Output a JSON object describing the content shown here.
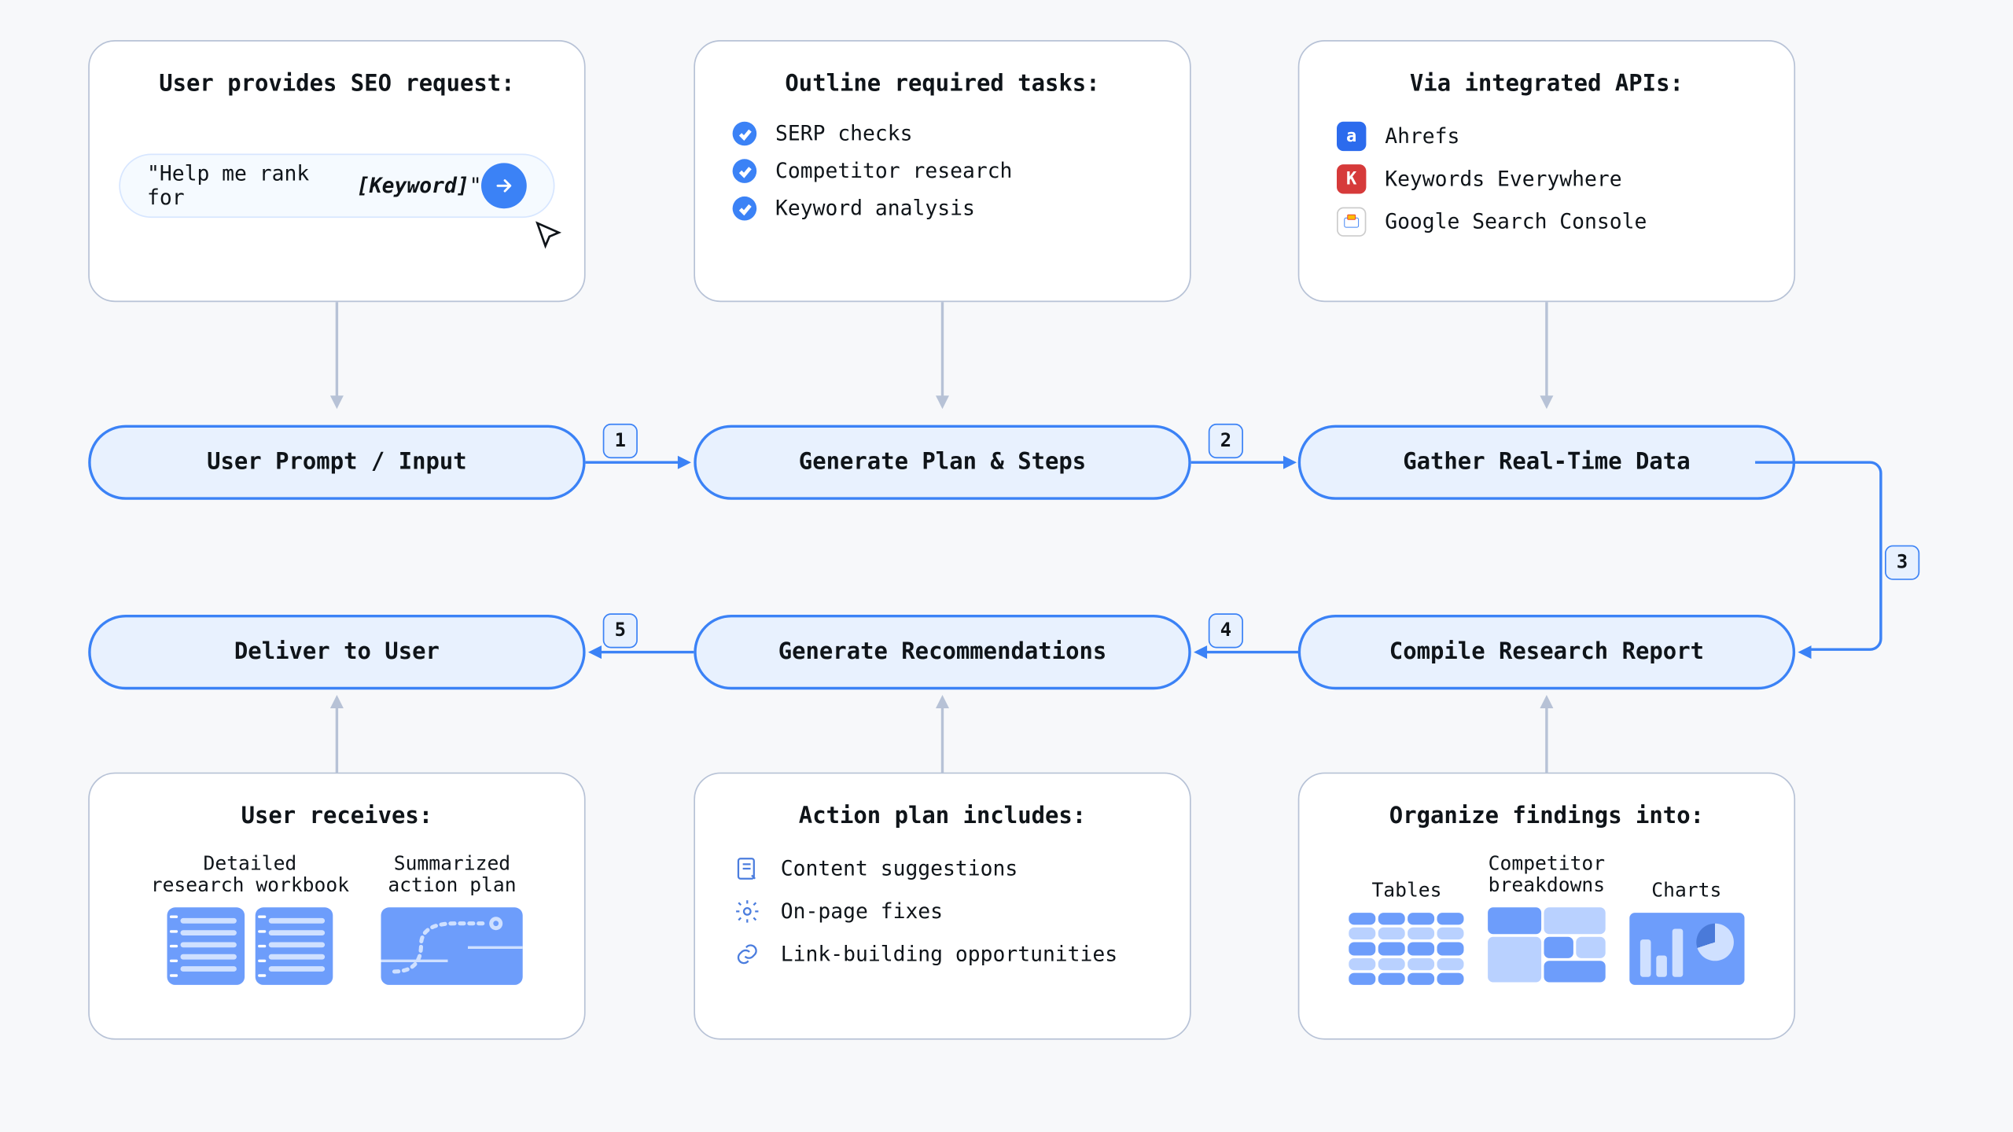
{
  "cards": {
    "top_left": {
      "title": "User provides SEO request:",
      "prompt_prefix": "\"Help me rank for ",
      "prompt_keyword": "[Keyword]",
      "prompt_suffix": "\""
    },
    "top_mid": {
      "title": "Outline required tasks:",
      "items": [
        "SERP checks",
        "Competitor research",
        "Keyword analysis"
      ]
    },
    "top_right": {
      "title": "Via integrated APIs:",
      "items": [
        "Ahrefs",
        "Keywords Everywhere",
        "Google Search Console"
      ]
    },
    "bot_left": {
      "title": "User receives:",
      "workbook_label": "Detailed\nresearch workbook",
      "plan_label": "Summarized\naction plan"
    },
    "bot_mid": {
      "title": "Action plan includes:",
      "items": [
        "Content suggestions",
        "On-page fixes",
        "Link-building opportunities"
      ]
    },
    "bot_right": {
      "title": "Organize findings into:",
      "labels": [
        "Tables",
        "Competitor\nbreakdowns",
        "Charts"
      ]
    }
  },
  "nodes": {
    "n1": "User Prompt / Input",
    "n2": "Generate Plan & Steps",
    "n3": "Gather Real-Time Data",
    "n4": "Compile Research Report",
    "n5": "Generate Recommendations",
    "n6": "Deliver to User"
  },
  "steps": {
    "s1": "1",
    "s2": "2",
    "s3": "3",
    "s4": "4",
    "s5": "5"
  }
}
